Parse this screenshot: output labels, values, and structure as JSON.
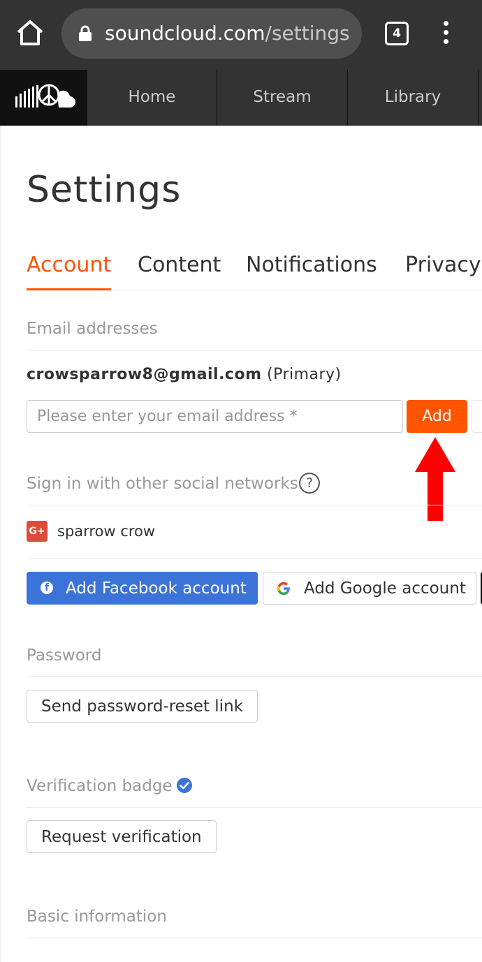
{
  "browser": {
    "url_domain": "soundcloud.com",
    "url_path": "/settings",
    "tab_count": "4"
  },
  "header": {
    "nav": [
      {
        "label": "Home"
      },
      {
        "label": "Stream"
      },
      {
        "label": "Library"
      }
    ]
  },
  "page": {
    "title": "Settings",
    "tabs": [
      {
        "label": "Account",
        "active": true
      },
      {
        "label": "Content",
        "active": false
      },
      {
        "label": "Notifications",
        "active": false
      },
      {
        "label": "Privacy",
        "active": false
      }
    ]
  },
  "email": {
    "section_label": "Email addresses",
    "primary_email": "crowsparrow8@gmail.com",
    "primary_tag": " (Primary)",
    "input_value": "",
    "input_placeholder": "Please enter your email address *",
    "add_label": "Add"
  },
  "social": {
    "section_label": "Sign in with other social networks",
    "help_glyph": "?",
    "connected_badge": "G+",
    "connected_name": "sparrow crow",
    "facebook_label": "Add Facebook account",
    "google_label": "Add Google account"
  },
  "password": {
    "section_label": "Password",
    "reset_label": "Send password-reset link"
  },
  "verification": {
    "section_label": "Verification badge",
    "request_label": "Request verification"
  },
  "basic": {
    "section_label": "Basic information"
  },
  "colors": {
    "accent": "#ff5500",
    "facebook": "#3b73d9",
    "google_plus": "#dd4b39",
    "chrome": "#333333",
    "annotation_arrow": "#ff0000"
  }
}
